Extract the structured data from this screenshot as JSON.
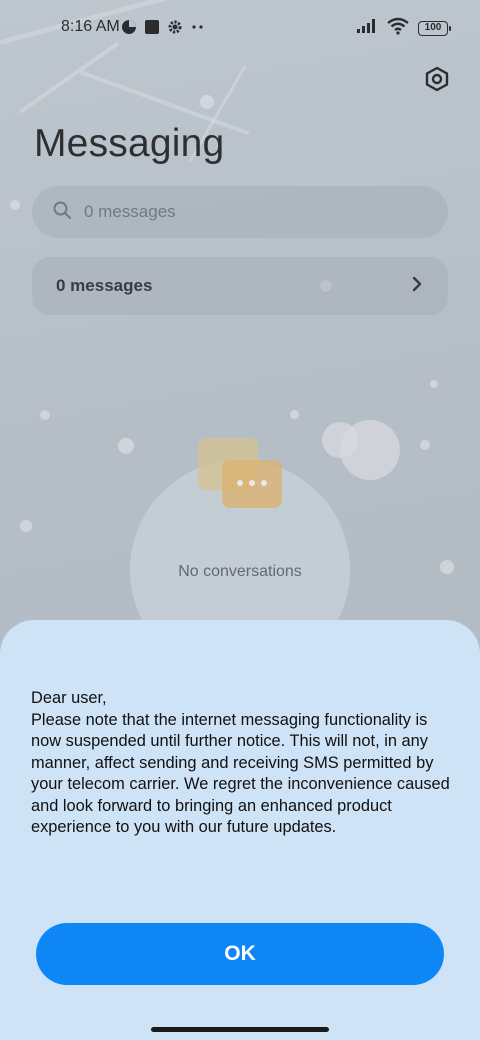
{
  "status_bar": {
    "time": "8:16 AM",
    "battery": "100",
    "left_icons": [
      "data-saver-icon",
      "square-app-icon",
      "gear-small-icon",
      "more-dots-icon"
    ],
    "right_icons": [
      "signal-icon",
      "wifi-icon",
      "battery-icon"
    ]
  },
  "header": {
    "title": "Messaging",
    "settings_icon": "settings-hexagon-icon"
  },
  "search": {
    "placeholder": "0 messages"
  },
  "folder": {
    "label": "0 messages"
  },
  "empty_state": {
    "text": "No conversations"
  },
  "dialog": {
    "message": "Dear user,\nPlease note that the internet messaging functionality is now suspended until further notice. This will not, in any manner, affect sending and receiving SMS permitted by your telecom carrier. We regret the inconvenience caused and look forward to bringing an enhanced product experience to you with our future updates.",
    "ok_label": "OK"
  },
  "colors": {
    "accent": "#0f86f6",
    "sheet_background": "#cfe3f7"
  }
}
